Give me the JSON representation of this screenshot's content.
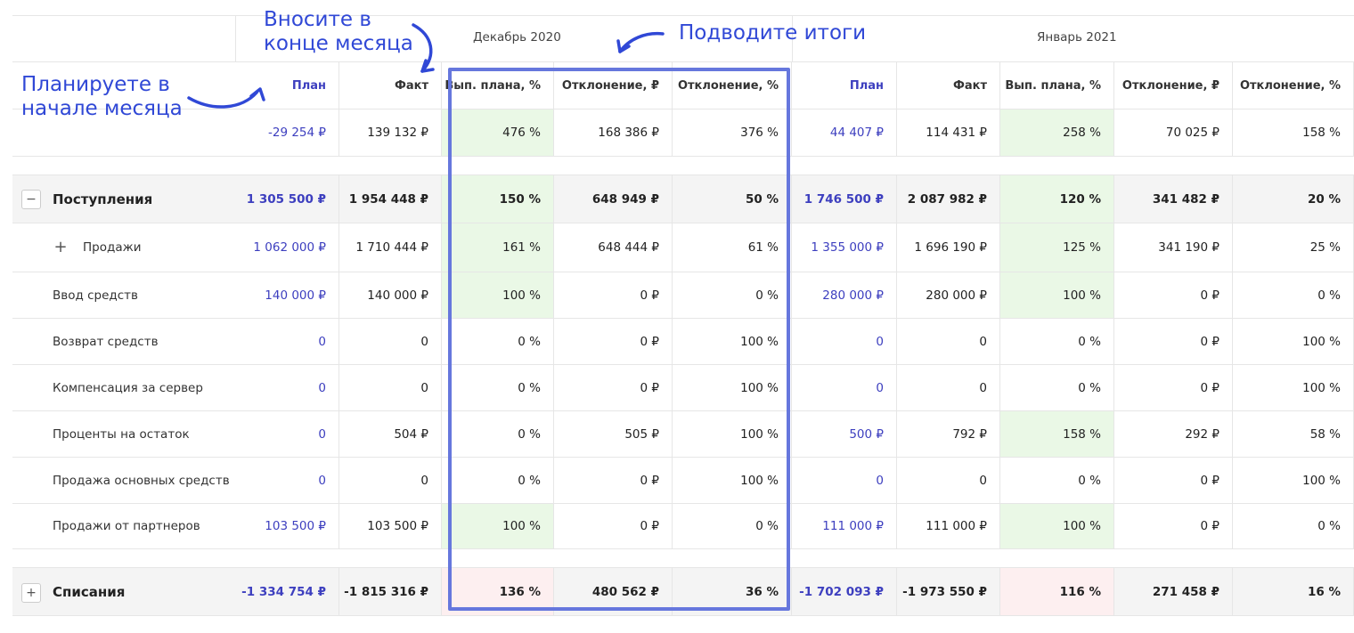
{
  "months": [
    "Декабрь 2020",
    "Январь 2021"
  ],
  "headers": [
    "План",
    "Факт",
    "Вып. плана, %",
    "Отклонение, ₽",
    "Отклонение, %"
  ],
  "annotations": {
    "plan_note": "Планируете в\nначале месяца",
    "fact_note": "Вносите в\nконце месяца",
    "summary_note": "Подводите итоги"
  },
  "totals": {
    "dec": [
      "-29 254 ₽",
      "139 132 ₽",
      "476 %",
      "168 386 ₽",
      "376 %"
    ],
    "jan": [
      "44 407 ₽",
      "114 431 ₽",
      "258 %",
      "70 025 ₽",
      "158 %"
    ]
  },
  "rows": [
    {
      "label": "Поступления",
      "toggle": "−",
      "dec": [
        "1 305 500 ₽",
        "1 954 448 ₽",
        "150 %",
        "648 949 ₽",
        "50 %"
      ],
      "jan": [
        "1 746 500 ₽",
        "2 087 982 ₽",
        "120 %",
        "341 482 ₽",
        "20 %"
      ]
    },
    {
      "label": "Продажи",
      "toggle": "+",
      "dec": [
        "1 062 000 ₽",
        "1 710 444 ₽",
        "161 %",
        "648 444 ₽",
        "61 %"
      ],
      "jan": [
        "1 355 000 ₽",
        "1 696 190 ₽",
        "125 %",
        "341 190 ₽",
        "25 %"
      ]
    },
    {
      "label": "Ввод средств",
      "dec": [
        "140 000 ₽",
        "140 000 ₽",
        "100 %",
        "0 ₽",
        "0 %"
      ],
      "jan": [
        "280 000 ₽",
        "280 000 ₽",
        "100 %",
        "0 ₽",
        "0 %"
      ]
    },
    {
      "label": "Возврат средств",
      "dec": [
        "0",
        "0",
        "0 %",
        "0 ₽",
        "100 %"
      ],
      "jan": [
        "0",
        "0",
        "0 %",
        "0 ₽",
        "100 %"
      ]
    },
    {
      "label": "Компенсация за сервер",
      "dec": [
        "0",
        "0",
        "0 %",
        "0 ₽",
        "100 %"
      ],
      "jan": [
        "0",
        "0",
        "0 %",
        "0 ₽",
        "100 %"
      ]
    },
    {
      "label": "Проценты на остаток",
      "dec": [
        "0",
        "504 ₽",
        "0 %",
        "505 ₽",
        "100 %"
      ],
      "jan": [
        "500 ₽",
        "792 ₽",
        "158 %",
        "292 ₽",
        "58 %"
      ]
    },
    {
      "label": "Продажа основных средств",
      "dec": [
        "0",
        "0",
        "0 %",
        "0 ₽",
        "100 %"
      ],
      "jan": [
        "0",
        "0",
        "0 %",
        "0 ₽",
        "100 %"
      ]
    },
    {
      "label": "Продажи от партнеров",
      "dec": [
        "103 500 ₽",
        "103 500 ₽",
        "100 %",
        "0 ₽",
        "0 %"
      ],
      "jan": [
        "111 000 ₽",
        "111 000 ₽",
        "100 %",
        "0 ₽",
        "0 %"
      ]
    },
    {
      "label": "Списания",
      "toggle": "+",
      "dec": [
        "-1 334 754 ₽",
        "-1 815 316 ₽",
        "136 %",
        "480 562 ₽",
        "36 %"
      ],
      "jan": [
        "-1 702 093 ₽",
        "-1 973 550 ₽",
        "116 %",
        "271 458 ₽",
        "16 %"
      ]
    }
  ],
  "colors": {
    "plan": "#3d3fbf",
    "highlight": "#6677dd",
    "green": "#eaf8e6",
    "pink": "#fdeff0",
    "annotation": "#3048d6"
  }
}
